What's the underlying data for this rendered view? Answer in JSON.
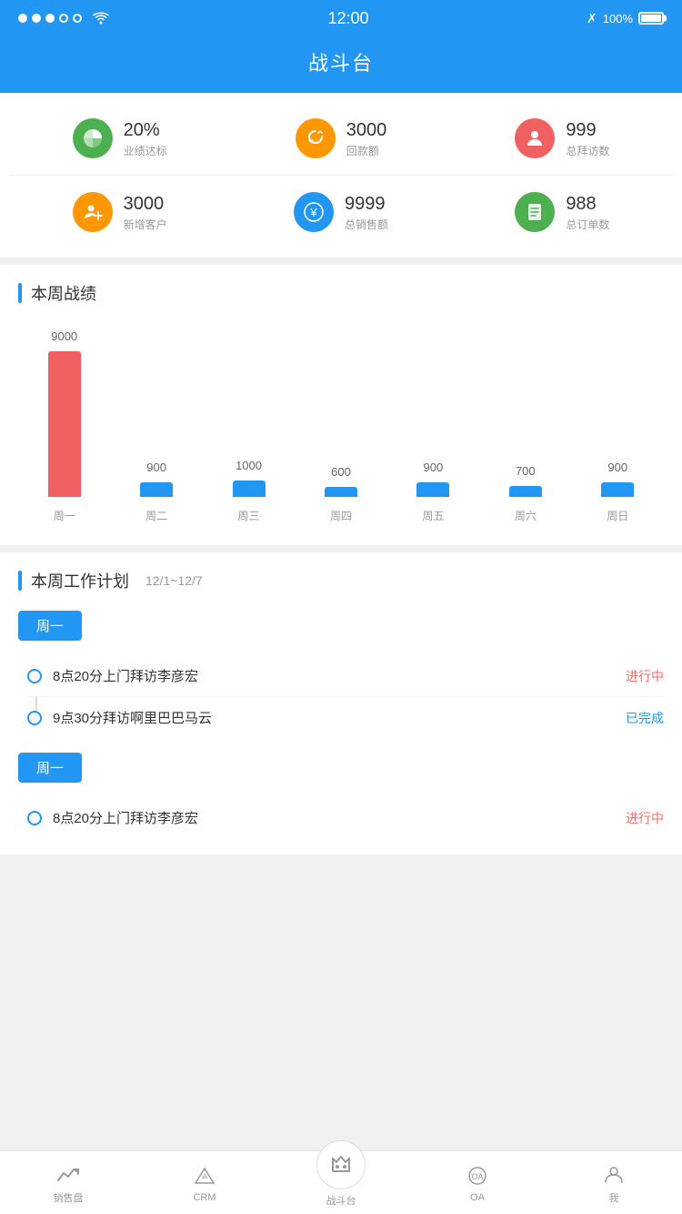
{
  "statusBar": {
    "time": "12:00",
    "batteryPercent": "100%"
  },
  "header": {
    "title": "战斗台"
  },
  "stats": {
    "row1": [
      {
        "icon": "pie-chart",
        "iconColor": "green",
        "number": "20%",
        "label": "业绩达标"
      },
      {
        "icon": "refresh",
        "iconColor": "orange",
        "number": "3000",
        "label": "回款额"
      },
      {
        "icon": "person",
        "iconColor": "red-orange",
        "number": "999",
        "label": "总拜访数"
      }
    ],
    "row2": [
      {
        "icon": "person-add",
        "iconColor": "orange",
        "number": "3000",
        "label": "新增客户"
      },
      {
        "icon": "yen",
        "iconColor": "blue",
        "number": "9999",
        "label": "总销售额"
      },
      {
        "icon": "list",
        "iconColor": "green",
        "number": "988",
        "label": "总订单数"
      }
    ]
  },
  "weeklyChart": {
    "sectionTitle": "本周战绩",
    "bars": [
      {
        "day": "周一",
        "value": 9000,
        "color": "red"
      },
      {
        "day": "周二",
        "value": 900,
        "color": "blue"
      },
      {
        "day": "周三",
        "value": 1000,
        "color": "blue"
      },
      {
        "day": "周四",
        "value": 600,
        "color": "blue"
      },
      {
        "day": "周五",
        "value": 900,
        "color": "blue"
      },
      {
        "day": "周六",
        "value": 700,
        "color": "blue"
      },
      {
        "day": "周日",
        "value": 900,
        "color": "blue"
      }
    ],
    "maxValue": 9000
  },
  "workPlan": {
    "sectionTitle": "本周工作计划",
    "dateRange": "12/1~12/7",
    "groups": [
      {
        "day": "周一",
        "items": [
          {
            "text": "8点20分上门拜访李彦宏",
            "status": "进行中",
            "statusType": "in-progress"
          },
          {
            "text": "9点30分拜访啊里巴巴马云",
            "status": "已完成",
            "statusType": "done"
          }
        ]
      },
      {
        "day": "周一",
        "items": [
          {
            "text": "8点20分上门拜访李彦宏",
            "status": "进行中",
            "statusType": "in-progress"
          }
        ]
      }
    ]
  },
  "bottomNav": {
    "items": [
      {
        "label": "销售盘",
        "icon": "chart-icon",
        "active": false
      },
      {
        "label": "CRM",
        "icon": "crm-icon",
        "active": false
      },
      {
        "label": "战斗台",
        "icon": "battle-icon",
        "active": true,
        "center": true
      },
      {
        "label": "OA",
        "icon": "oa-icon",
        "active": false
      },
      {
        "label": "我",
        "icon": "me-icon",
        "active": false
      }
    ]
  }
}
